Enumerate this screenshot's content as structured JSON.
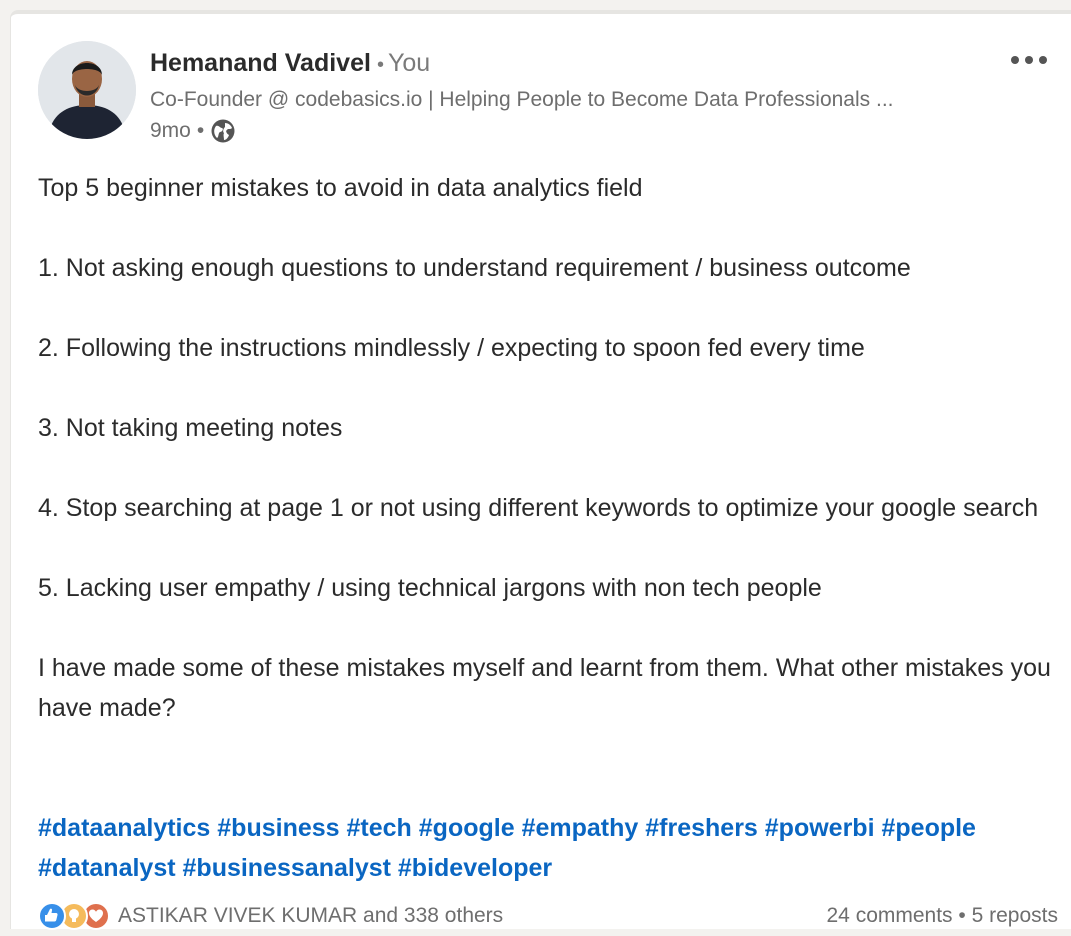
{
  "actor": {
    "name": "Hemanand Vadivel",
    "separator": "•",
    "relation": "You",
    "headline": "Co-Founder @ codebasics.io | Helping People to Become Data Professionals ...",
    "time": "9mo",
    "meta_separator": "•",
    "visibility_icon": "globe-icon"
  },
  "menu": {
    "icon": "more-horizontal-icon"
  },
  "post": {
    "paragraphs": [
      "Top 5 beginner mistakes to avoid in data analytics field",
      "1. Not asking enough questions to understand requirement / business outcome",
      "2. Following the instructions mindlessly / expecting to spoon fed every time",
      "3. Not taking meeting notes",
      "4. Stop searching at page 1 or not using different keywords to optimize your google search",
      "5. Lacking user empathy / using technical jargons with non tech people",
      "I have made some of these mistakes myself and learnt from them. What other mistakes you have made?"
    ],
    "hashtags": [
      "#dataanalytics",
      "#business",
      "#tech",
      "#google",
      "#empathy",
      "#freshers",
      "#powerbi",
      "#people",
      "#datanalyst",
      "#businessanalyst",
      "#bideveloper"
    ]
  },
  "social": {
    "reaction_icons": [
      "like-icon",
      "insightful-icon",
      "love-icon"
    ],
    "reactions_text": "ASTIKAR VIVEK KUMAR and 338 others",
    "comments": "24 comments",
    "separator": "•",
    "reposts": "5 reposts"
  },
  "colors": {
    "hashtag": "#0a66c2",
    "like": "#378fe9",
    "insightful": "#f5bb5c",
    "love": "#df704d"
  }
}
